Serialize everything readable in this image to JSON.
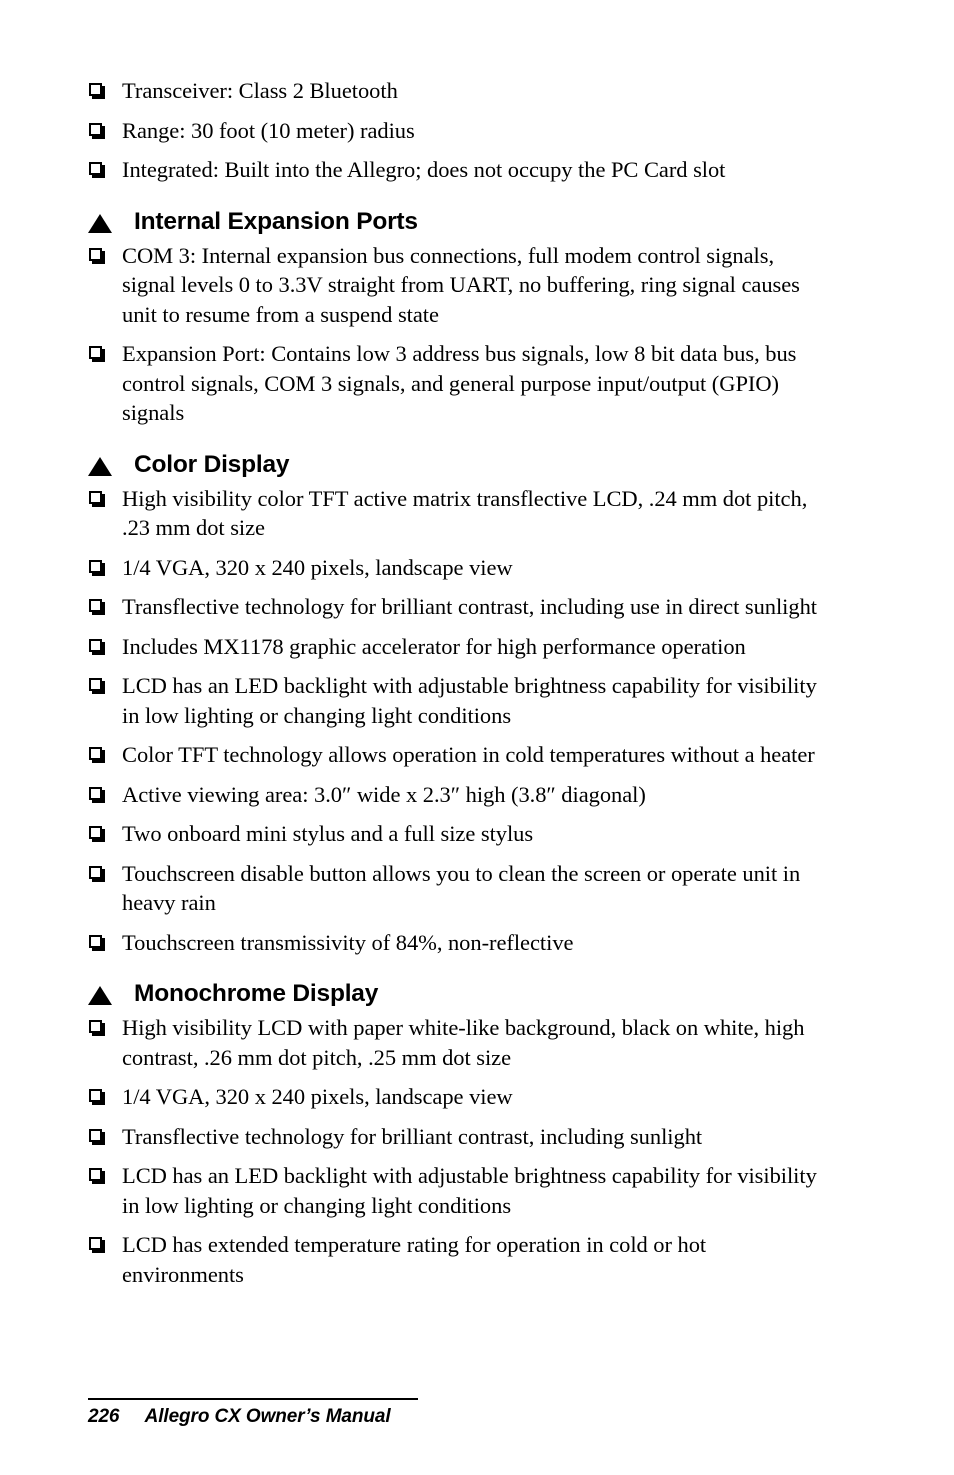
{
  "document": {
    "bullet_glyph": "hollow-square-shadow",
    "heading_glyph": "solid-up-triangle"
  },
  "intro_list": [
    "Transceiver: Class 2 Bluetooth",
    "Range: 30 foot (10 meter) radius",
    "Integrated: Built into the Allegro; does not occupy the PC Card slot"
  ],
  "sections": [
    {
      "heading": "Internal Expansion Ports",
      "items": [
        "COM 3: Internal expansion bus connections, full modem control signals, signal levels 0 to 3.3V straight from UART, no buffering, ring signal causes unit to resume from a suspend state",
        "Expansion Port: Contains low 3 address bus signals, low 8 bit data bus, bus control signals, COM 3 signals, and general purpose input/output (GPIO) signals"
      ]
    },
    {
      "heading": "Color Display",
      "items": [
        "High visibility color TFT active matrix transflective LCD, .24 mm dot pitch, .23 mm dot size",
        "1/4 VGA, 320 x 240 pixels, landscape view",
        "Transflective technology for brilliant contrast, including use in direct sunlight",
        "Includes MX1178 graphic accelerator for high performance operation",
        "LCD has an LED backlight with adjustable brightness capability for visibility in low lighting or changing light conditions",
        "Color TFT technology allows operation in cold temperatures without a heater",
        "Active viewing area: 3.0″ wide x 2.3″ high (3.8″ diagonal)",
        "Two onboard mini stylus and a full size stylus",
        "Touchscreen disable button allows you to clean the screen or operate unit in heavy rain",
        "Touchscreen transmissivity of 84%, non-reflective"
      ]
    },
    {
      "heading": "Monochrome Display",
      "items": [
        "High visibility LCD with paper white-like background, black on white, high contrast, .26 mm dot pitch, .25 mm dot size",
        "1/4 VGA, 320 x 240 pixels, landscape view",
        "Transflective technology for brilliant contrast, including sunlight",
        "LCD has an LED backlight with adjustable brightness capability for visibility in low lighting or changing light conditions",
        "LCD has extended temperature rating for operation in cold or hot environments"
      ]
    }
  ],
  "footer": {
    "page_number": "226",
    "title": "Allegro CX Owner’s Manual",
    "combined": "226     Allegro CX Owner’s Manual"
  }
}
